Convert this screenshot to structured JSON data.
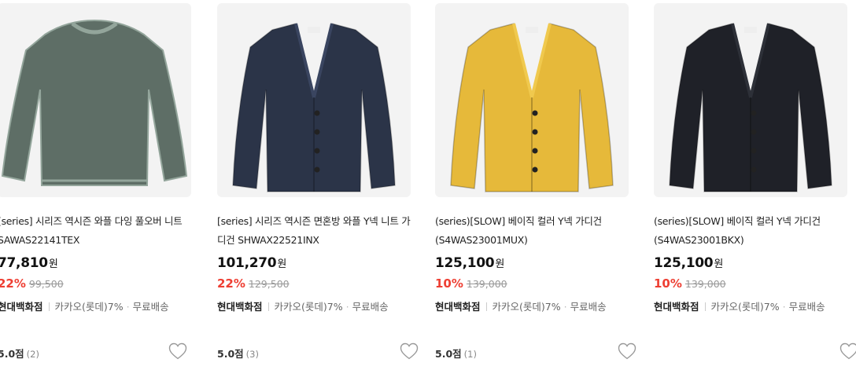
{
  "products": [
    {
      "title": "[series] 시리즈 역시즌 와플 다잉 풀오버 니트 SAWAS22141TEX",
      "price": "77,810",
      "won": "원",
      "discount": "22%",
      "original_price": "99,500",
      "store": "현대백화점",
      "card_benefit": "카카오(롯데)7%",
      "shipping": "무료배송",
      "rating": "5.0점",
      "review_count": "(2)",
      "garment": "pullover",
      "color": "#5e6e66",
      "accent": "#93a59b"
    },
    {
      "title": "[series] 시리즈 역시즌 면혼방 와플 Y넥 니트 가디건 SHWAX22521INX",
      "price": "101,270",
      "won": "원",
      "discount": "22%",
      "original_price": "129,500",
      "store": "현대백화점",
      "card_benefit": "카카오(롯데)7%",
      "shipping": "무료배송",
      "rating": "5.0점",
      "review_count": "(3)",
      "garment": "cardigan",
      "color": "#2b3448",
      "accent": "#3a4560"
    },
    {
      "title": "(series)[SLOW] 베이직 컬러 Y넥 가디건(S4WAS23001MUX)",
      "price": "125,100",
      "won": "원",
      "discount": "10%",
      "original_price": "139,000",
      "store": "현대백화점",
      "card_benefit": "카카오(롯데)7%",
      "shipping": "무료배송",
      "rating": "5.0점",
      "review_count": "(1)",
      "garment": "cardigan",
      "color": "#e6b93a",
      "accent": "#f0c94e"
    },
    {
      "title": "(series)[SLOW] 베이직 컬러 Y넥 가디건(S4WAS23001BKX)",
      "price": "125,100",
      "won": "원",
      "discount": "10%",
      "original_price": "139,000",
      "store": "현대백화점",
      "card_benefit": "카카오(롯데)7%",
      "shipping": "무료배송",
      "rating": "",
      "review_count": "",
      "garment": "cardigan",
      "color": "#1f2128",
      "accent": "#2d3038"
    }
  ],
  "icons": {
    "wishlist": "heart-outline-icon"
  },
  "colors": {
    "discount": "#ee3f33",
    "card_bg": "#f3f3f3"
  }
}
